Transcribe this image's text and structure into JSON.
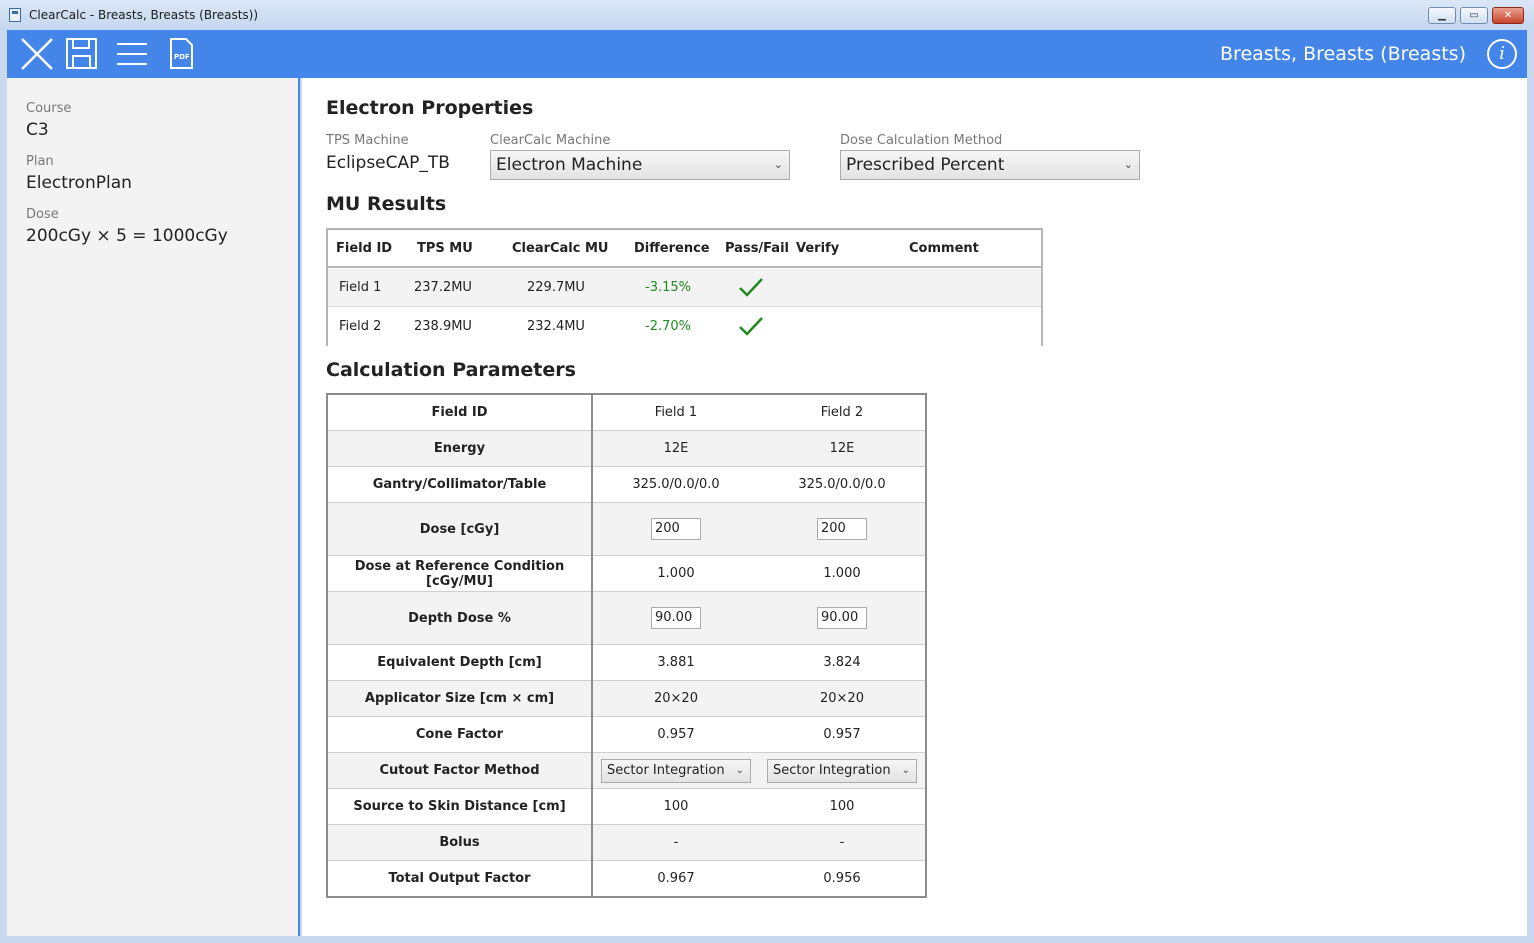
{
  "window": {
    "title": "ClearCalc - Breasts, Breasts (Breasts))"
  },
  "header": {
    "title": "Breasts, Breasts (Breasts)",
    "info_glyph": "i"
  },
  "sidebar": {
    "course_label": "Course",
    "course_value": "C3",
    "plan_label": "Plan",
    "plan_value": "ElectronPlan",
    "dose_label": "Dose",
    "dose_value": "200cGy × 5 = 1000cGy"
  },
  "electron_properties": {
    "title": "Electron Properties",
    "tps_machine_label": "TPS Machine",
    "tps_machine_value": "EclipseCAP_TB",
    "clearcalc_machine_label": "ClearCalc Machine",
    "clearcalc_machine_value": "Electron Machine",
    "dose_method_label": "Dose Calculation Method",
    "dose_method_value": "Prescribed Percent"
  },
  "mu_results": {
    "title": "MU Results",
    "headers": [
      "Field ID",
      "TPS MU",
      "ClearCalc MU",
      "Difference",
      "Pass/Fail",
      "Verify",
      "Comment"
    ],
    "rows": [
      {
        "field": "Field 1",
        "tps": "237.2MU",
        "clearcalc": "229.7MU",
        "diff": "-3.15%",
        "status": "pass"
      },
      {
        "field": "Field 2",
        "tps": "238.9MU",
        "clearcalc": "232.4MU",
        "diff": "-2.70%",
        "status": "pass"
      }
    ]
  },
  "calc_params": {
    "title": "Calculation Parameters",
    "rows": [
      {
        "label": "Field ID",
        "v1": "Field 1",
        "v2": "Field 2",
        "kind": "text"
      },
      {
        "label": "Energy",
        "v1": "12E",
        "v2": "12E",
        "kind": "text"
      },
      {
        "label": "Gantry/Collimator/Table",
        "v1": "325.0/0.0/0.0",
        "v2": "325.0/0.0/0.0",
        "kind": "text"
      },
      {
        "label": "Dose [cGy]",
        "v1": "200",
        "v2": "200",
        "kind": "input"
      },
      {
        "label": "Dose at Reference Condition [cGy/MU]",
        "v1": "1.000",
        "v2": "1.000",
        "kind": "text"
      },
      {
        "label": "Depth Dose %",
        "v1": "90.00",
        "v2": "90.00",
        "kind": "input"
      },
      {
        "label": "Equivalent Depth [cm]",
        "v1": "3.881",
        "v2": "3.824",
        "kind": "text"
      },
      {
        "label": "Applicator Size [cm × cm]",
        "v1": "20×20",
        "v2": "20×20",
        "kind": "text"
      },
      {
        "label": "Cone Factor",
        "v1": "0.957",
        "v2": "0.957",
        "kind": "text"
      },
      {
        "label": "Cutout Factor Method",
        "v1": "Sector Integration",
        "v2": "Sector Integration",
        "kind": "select"
      },
      {
        "label": "Source to Skin Distance [cm]",
        "v1": "100",
        "v2": "100",
        "kind": "text"
      },
      {
        "label": "Bolus",
        "v1": "-",
        "v2": "-",
        "kind": "text"
      },
      {
        "label": "Total Output Factor",
        "v1": "0.967",
        "v2": "0.956",
        "kind": "text"
      }
    ]
  },
  "colors": {
    "accent": "#4485ea",
    "pass": "#1e8a1e"
  }
}
